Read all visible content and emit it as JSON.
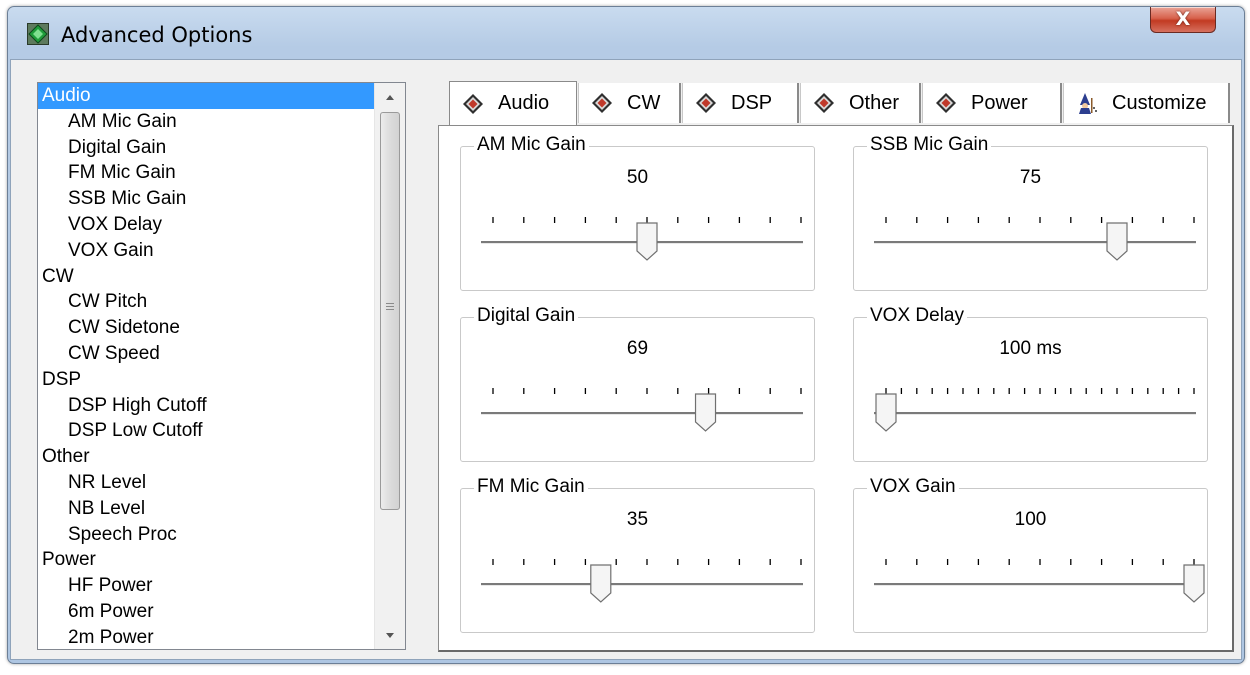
{
  "window": {
    "title": "Advanced Options",
    "close_label": "X"
  },
  "tree": {
    "items": [
      {
        "label": "Audio",
        "level": 0,
        "selected": true
      },
      {
        "label": "AM Mic Gain",
        "level": 1
      },
      {
        "label": "Digital Gain",
        "level": 1
      },
      {
        "label": "FM Mic Gain",
        "level": 1
      },
      {
        "label": "SSB Mic Gain",
        "level": 1
      },
      {
        "label": "VOX Delay",
        "level": 1
      },
      {
        "label": "VOX Gain",
        "level": 1
      },
      {
        "label": "CW",
        "level": 0
      },
      {
        "label": "CW Pitch",
        "level": 1
      },
      {
        "label": "CW Sidetone",
        "level": 1
      },
      {
        "label": "CW Speed",
        "level": 1
      },
      {
        "label": "DSP",
        "level": 0
      },
      {
        "label": "DSP High Cutoff",
        "level": 1
      },
      {
        "label": "DSP Low Cutoff",
        "level": 1
      },
      {
        "label": "Other",
        "level": 0
      },
      {
        "label": "NR Level",
        "level": 1
      },
      {
        "label": "NB Level",
        "level": 1
      },
      {
        "label": "Speech Proc",
        "level": 1
      },
      {
        "label": "Power",
        "level": 0
      },
      {
        "label": "HF Power",
        "level": 1
      },
      {
        "label": "6m Power",
        "level": 1
      },
      {
        "label": "2m Power",
        "level": 1
      }
    ]
  },
  "tabs": [
    {
      "label": "Audio",
      "icon": "diamond-icon",
      "active": true
    },
    {
      "label": "CW",
      "icon": "diamond-icon"
    },
    {
      "label": "DSP",
      "icon": "diamond-icon"
    },
    {
      "label": "Other",
      "icon": "diamond-icon"
    },
    {
      "label": "Power",
      "icon": "diamond-icon"
    },
    {
      "label": "Customize",
      "icon": "wizard-icon"
    }
  ],
  "controls": [
    {
      "label": "AM Mic Gain",
      "value": "50",
      "fraction": 0.5,
      "ticks": 11
    },
    {
      "label": "SSB Mic Gain",
      "value": "75",
      "fraction": 0.75,
      "ticks": 11
    },
    {
      "label": "Digital Gain",
      "value": "69",
      "fraction": 0.69,
      "ticks": 11
    },
    {
      "label": "VOX Delay",
      "value": "100 ms",
      "fraction": 0.0,
      "ticks": 21
    },
    {
      "label": "FM Mic Gain",
      "value": "35",
      "fraction": 0.35,
      "ticks": 11
    },
    {
      "label": "VOX Gain",
      "value": "100",
      "fraction": 1.0,
      "ticks": 11
    }
  ],
  "colors": {
    "selection": "#3399ff",
    "icon_red": "#c0392b",
    "icon_frame": "#3a3a3a"
  }
}
